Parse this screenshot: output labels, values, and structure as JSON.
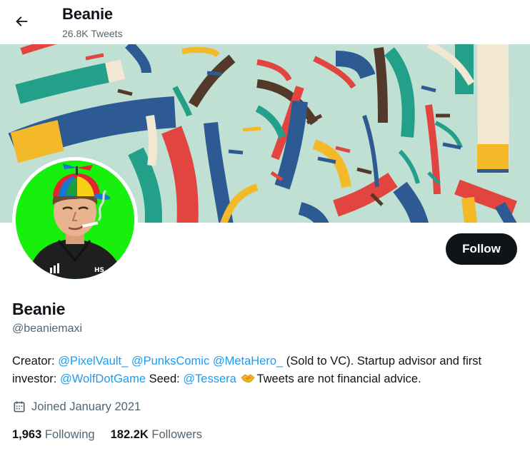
{
  "header": {
    "title": "Beanie",
    "tweet_count": "26.8K Tweets",
    "back_icon": "arrow-left-icon"
  },
  "banner": {
    "background": "#bfe0d3",
    "palette": [
      "#e2453f",
      "#f3b928",
      "#2e5a93",
      "#23a089",
      "#52392a",
      "#f1e7d3"
    ]
  },
  "avatar": {
    "background": "#16f00c"
  },
  "follow_button": {
    "label": "Follow"
  },
  "profile": {
    "display_name": "Beanie",
    "handle": "@beaniemaxi",
    "bio": {
      "t1": "Creator: ",
      "m1": "@PixelVault_",
      "m2": "@PunksComic",
      "m3": "@MetaHero_",
      "t2": " (Sold to VC). Startup advisor and first investor: ",
      "m4": "@WolfDotGame",
      "t3": " Seed: ",
      "m5": "@Tessera",
      "t4": "Tweets are not financial advice.",
      "emoji_icon": "handshake-icon"
    },
    "joined": "Joined January 2021",
    "joined_icon": "calendar-icon"
  },
  "stats": {
    "following_count": "1,963",
    "following_label": "Following",
    "followers_count": "182.2K",
    "followers_label": "Followers"
  },
  "colors": {
    "text_primary": "#0f1419",
    "text_secondary": "#536471",
    "link": "#1d9bf0",
    "button_bg": "#0f1419"
  }
}
